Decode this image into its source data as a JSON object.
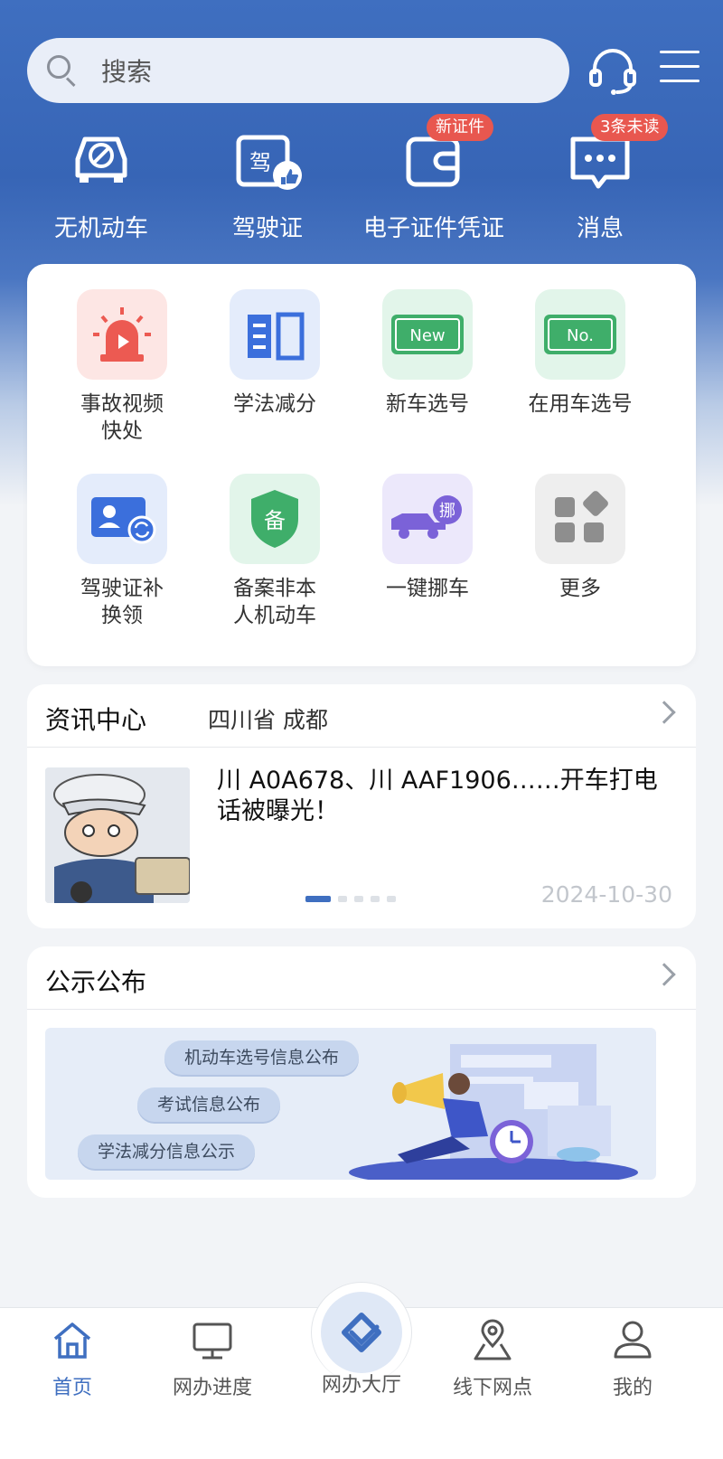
{
  "header": {
    "search_placeholder": "搜索",
    "icons": [
      "search-icon",
      "headset-icon",
      "menu-icon"
    ]
  },
  "quick_actions": [
    {
      "label": "无机动车",
      "icon": "car-forbidden-icon",
      "badge": ""
    },
    {
      "label": "驾驶证",
      "icon": "license-thumb-icon",
      "badge": ""
    },
    {
      "label": "电子证件凭证",
      "icon": "wallet-icon",
      "badge": "新证件"
    },
    {
      "label": "消息",
      "icon": "chat-bubble-icon",
      "badge": "3条未读"
    }
  ],
  "services": [
    {
      "name": "事故视频\n快处",
      "icon": "siren-icon",
      "tile_color": "#fde6e4"
    },
    {
      "name": "学法减分",
      "icon": "book-icon",
      "tile_color": "#e4ecfb"
    },
    {
      "name": "新车选号",
      "icon": "plate-new-icon",
      "tile_color": "#e2f5ea"
    },
    {
      "name": "在用车选号",
      "icon": "plate-no-icon",
      "tile_color": "#e2f5ea"
    },
    {
      "name": "驾驶证补\n换领",
      "icon": "id-card-swap-icon",
      "tile_color": "#e4ecfb"
    },
    {
      "name": "备案非本\n人机动车",
      "icon": "shield-record-icon",
      "tile_color": "#e2f5ea"
    },
    {
      "name": "一键挪车",
      "icon": "tow-truck-icon",
      "tile_color": "#ece8fb"
    },
    {
      "name": "更多",
      "icon": "more-grid-icon",
      "tile_color": "#eeeeee"
    }
  ],
  "plate_texts": {
    "new": "New",
    "no": "No.",
    "record": "备",
    "move": "挪"
  },
  "news": {
    "title": "资讯中心",
    "region": "四川省 成都",
    "headline": "川 A0A678、川 AAF1906……开车打电话被曝光！",
    "date": "2024-10-30",
    "carousel_count": 5,
    "carousel_active": 1
  },
  "publications": {
    "title": "公示公布",
    "items": [
      "机动车选号信息公布",
      "考试信息公布",
      "学法减分信息公示"
    ]
  },
  "tabbar": [
    {
      "label": "首页",
      "icon": "home-icon",
      "active": true
    },
    {
      "label": "网办进度",
      "icon": "monitor-icon",
      "active": false
    },
    {
      "label": "网办大厅",
      "icon": "hall-handshake-icon",
      "active": false
    },
    {
      "label": "线下网点",
      "icon": "map-pin-icon",
      "active": false
    },
    {
      "label": "我的",
      "icon": "user-icon",
      "active": false
    }
  ],
  "colors": {
    "brand": "#3f6fc0",
    "badge": "#e8574f",
    "accent_red": "#ec5a52",
    "accent_blue": "#3b6fdc",
    "accent_green": "#3fae6a",
    "accent_purple": "#7b62d8"
  }
}
